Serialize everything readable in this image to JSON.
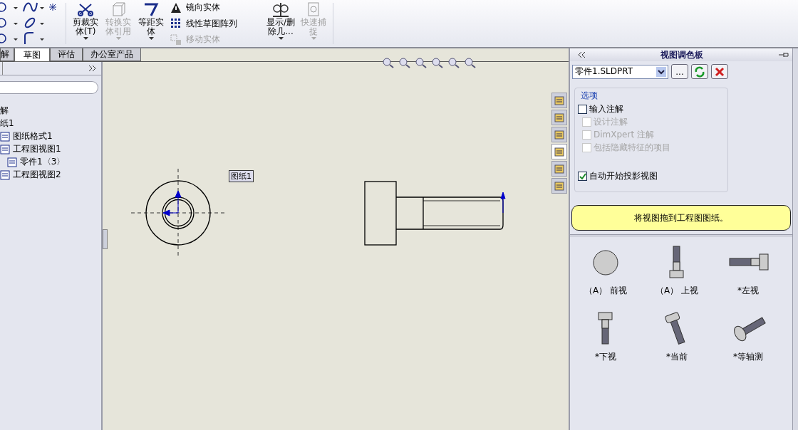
{
  "toolbar": {
    "commands": [
      {
        "kind": "large",
        "label": "剪裁实体(T)",
        "disabled": false
      },
      {
        "kind": "large",
        "label": "转换实体引用",
        "disabled": true
      },
      {
        "kind": "large",
        "label": "等距实体",
        "disabled": false
      },
      {
        "kind": "stack",
        "items": [
          {
            "label": "镜向实体",
            "disabled": false
          },
          {
            "label": "线性草图阵列",
            "disabled": false
          },
          {
            "label": "移动实体",
            "disabled": true
          }
        ]
      },
      {
        "kind": "large",
        "label": "显示/删除几...",
        "disabled": false
      },
      {
        "kind": "large",
        "label": "快速捕捉",
        "disabled": true
      }
    ]
  },
  "tabs": [
    {
      "label": "解",
      "selected": false
    },
    {
      "label": "草图",
      "selected": true
    },
    {
      "label": "评估",
      "selected": false
    },
    {
      "label": "办公室产品",
      "selected": false
    }
  ],
  "feature_tree": {
    "items": [
      {
        "label": "解"
      },
      {
        "label": "纸1",
        "children": [
          {
            "label": "图纸格式1"
          },
          {
            "label": "工程图视图1",
            "children": [
              {
                "label": "零件1〈3〉"
              }
            ]
          },
          {
            "label": "工程图视图2"
          }
        ]
      }
    ]
  },
  "canvas": {
    "sheet_label": "图纸1"
  },
  "task_pane_tabs": [
    {
      "selected": false
    },
    {
      "selected": false
    },
    {
      "selected": false
    },
    {
      "selected": true
    },
    {
      "selected": false
    },
    {
      "selected": false
    }
  ],
  "view_palette": {
    "title": "视图调色板",
    "file": "零件1.SLDPRT",
    "browse_label": "...",
    "options_title": "选项",
    "options": [
      {
        "label": "输入注解",
        "checked": false,
        "disabled": false,
        "children": [
          {
            "label": "设计注解",
            "checked": false,
            "disabled": true
          },
          {
            "label": "DimXpert 注解",
            "checked": false,
            "disabled": true
          },
          {
            "label": "包括隐藏特征的项目",
            "checked": false,
            "disabled": true
          }
        ]
      },
      {
        "label": "自动开始投影视图",
        "checked": true,
        "disabled": false
      }
    ],
    "message": "将视图拖到工程图图纸。",
    "views": [
      {
        "label": "（A） 前视",
        "kind": "front"
      },
      {
        "label": "（A） 上视",
        "kind": "top"
      },
      {
        "label": "*左视",
        "kind": "left"
      },
      {
        "label": "*下视",
        "kind": "bottom"
      },
      {
        "label": "*当前",
        "kind": "current"
      },
      {
        "label": "*等轴测",
        "kind": "iso"
      }
    ]
  }
}
